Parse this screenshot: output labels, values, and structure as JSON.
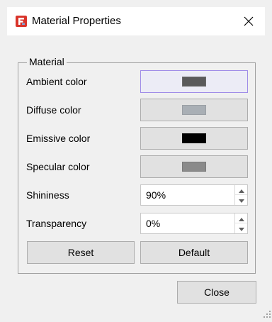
{
  "window": {
    "title": "Material Properties",
    "app_icon": "freecad-logo-icon",
    "close_icon": "close-icon"
  },
  "material": {
    "group_title": "Material",
    "rows": [
      {
        "label": "Ambient color",
        "swatch": "#5a5a5a"
      },
      {
        "label": "Diffuse color",
        "swatch": "#a9afb5"
      },
      {
        "label": "Emissive color",
        "swatch": "#000000"
      },
      {
        "label": "Specular color",
        "swatch": "#8a8a8a"
      }
    ],
    "shininess": {
      "label": "Shininess",
      "value": "90%"
    },
    "transparency": {
      "label": "Transparency",
      "value": "0%"
    },
    "reset_label": "Reset",
    "default_label": "Default"
  },
  "close_label": "Close"
}
